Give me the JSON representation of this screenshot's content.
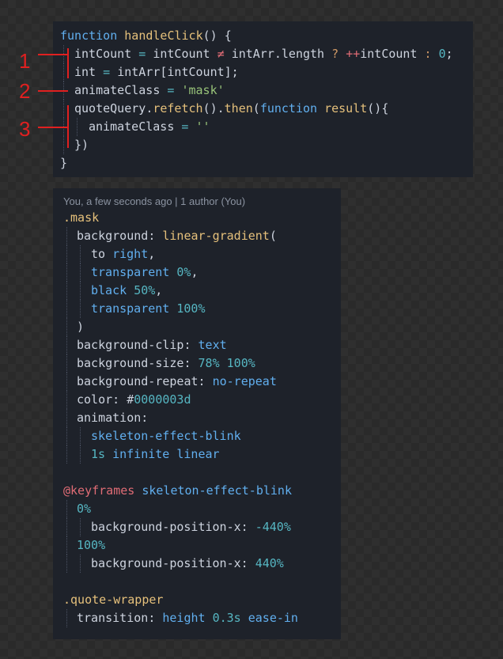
{
  "top_code": {
    "l1": [
      "function",
      "handleClick",
      "() {"
    ],
    "l2": [
      "intCount",
      " = ",
      "intCount",
      " ≠ ",
      "intArr",
      ".length",
      " ? ",
      "++",
      "intCount",
      " : ",
      "0",
      ";"
    ],
    "l3": [
      "int",
      " = ",
      "intArr",
      "[intCount];"
    ],
    "l4": [
      "animateClass",
      " = ",
      "'mask'"
    ],
    "l5": [
      "quoteQuery",
      ".",
      "refetch",
      "().",
      "then",
      "(",
      "function",
      " ",
      "result",
      "(){"
    ],
    "l6": [
      "animateClass",
      " = ",
      "''"
    ],
    "l7": [
      "})"
    ],
    "l8": [
      "}"
    ]
  },
  "annotations": {
    "marker_1": "1",
    "marker_2": "2",
    "marker_3": "3"
  },
  "blame": "You, a few seconds ago | 1 author (You)",
  "css_code": {
    "l1": ".mask",
    "l2": [
      "background",
      ": ",
      "linear-gradient",
      "("
    ],
    "l3": [
      "to",
      " ",
      "right",
      ","
    ],
    "l4": [
      "transparent",
      " ",
      "0%",
      ","
    ],
    "l5": [
      "black",
      " ",
      "50%",
      ","
    ],
    "l6": [
      "transparent",
      " ",
      "100%"
    ],
    "l7": ")",
    "l8": [
      "background-clip",
      ": ",
      "text"
    ],
    "l9": [
      "background-size",
      ": ",
      "78%",
      " ",
      "100%"
    ],
    "l10": [
      "background-repeat",
      ": ",
      "no-repeat"
    ],
    "l11": [
      "color",
      ": ",
      "#",
      "0000003d"
    ],
    "l12": [
      "animation",
      ":"
    ],
    "l13": "skeleton-effect-blink",
    "l14": [
      "1s",
      " ",
      "infinite",
      " ",
      "linear"
    ],
    "l16": [
      "@keyframes",
      " ",
      "skeleton-effect-blink"
    ],
    "l17": "0%",
    "l18": [
      "background-position-x",
      ": ",
      "-440%"
    ],
    "l19": "100%",
    "l20": [
      "background-position-x",
      ": ",
      "440%"
    ],
    "l22": ".quote-wrapper",
    "l23": [
      "transition",
      ": ",
      "height",
      " ",
      "0.3s",
      " ",
      "ease-in"
    ]
  },
  "colors": {
    "panel_bg": "#1e222a",
    "keyword": "#61afef",
    "function_name": "#e5c07b",
    "string": "#98c379",
    "number": "#56b6c2",
    "annotation_red": "#e02020"
  }
}
